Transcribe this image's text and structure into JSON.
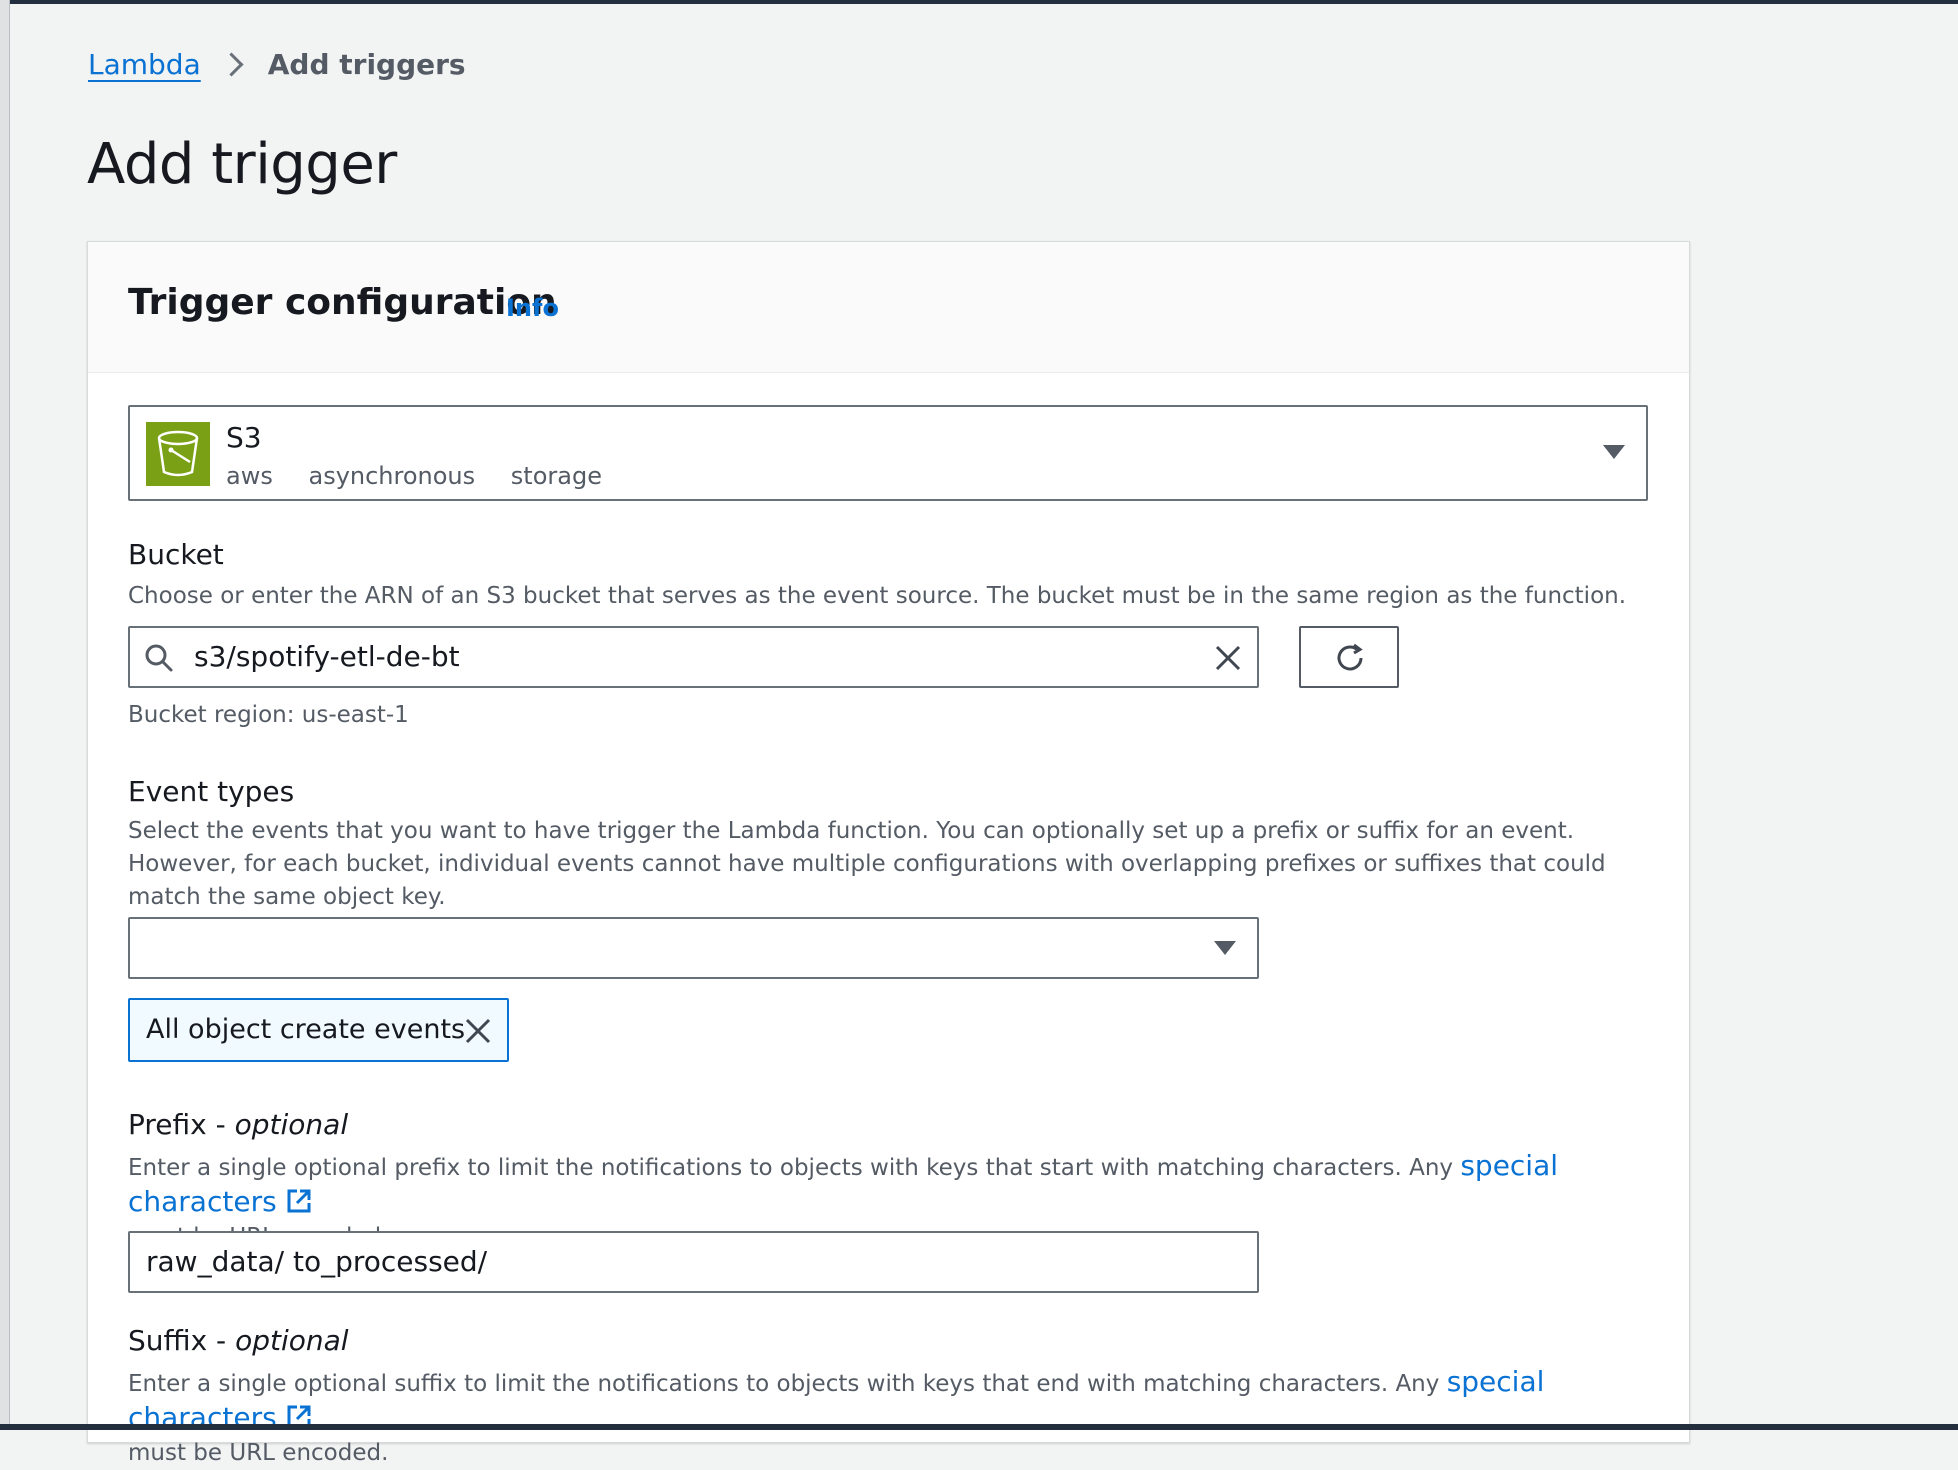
{
  "breadcrumb": {
    "root": "Lambda",
    "current": "Add triggers"
  },
  "page": {
    "title": "Add trigger"
  },
  "card": {
    "title": "Trigger configuration",
    "info_link": "Info"
  },
  "service": {
    "name": "S3",
    "tags": [
      "aws",
      "asynchronous",
      "storage"
    ],
    "icon": "s3-bucket-icon",
    "icon_color": "#7aa116"
  },
  "bucket": {
    "label": "Bucket",
    "description": "Choose or enter the ARN of an S3 bucket that serves as the event source. The bucket must be in the same region as the function.",
    "value": "s3/spotify-etl-de-bt",
    "region_note": "Bucket region: us-east-1"
  },
  "event_types": {
    "label": "Event types",
    "description": "Select the events that you want to have trigger the Lambda function. You can optionally set up a prefix or suffix for an event. However, for each bucket, individual events cannot have multiple configurations with overlapping prefixes or suffixes that could match the same object key.",
    "selected": "",
    "tokens": [
      "All object create events"
    ]
  },
  "prefix": {
    "label": "Prefix -",
    "optional": "optional",
    "description_before": "Enter a single optional prefix to limit the notifications to objects with keys that start with matching characters. Any",
    "link": "special characters",
    "description_after": "must be URL encoded.",
    "value": "raw_data/ to_processed/"
  },
  "suffix": {
    "label": "Suffix -",
    "optional": "optional",
    "description_before": "Enter a single optional suffix to limit the notifications to objects with keys that end with matching characters. Any",
    "link": "special characters",
    "description_after": "must be URL encoded."
  },
  "colors": {
    "link": "#0972d3",
    "token_border": "#0972d3",
    "header_bar": "#232f3e"
  }
}
